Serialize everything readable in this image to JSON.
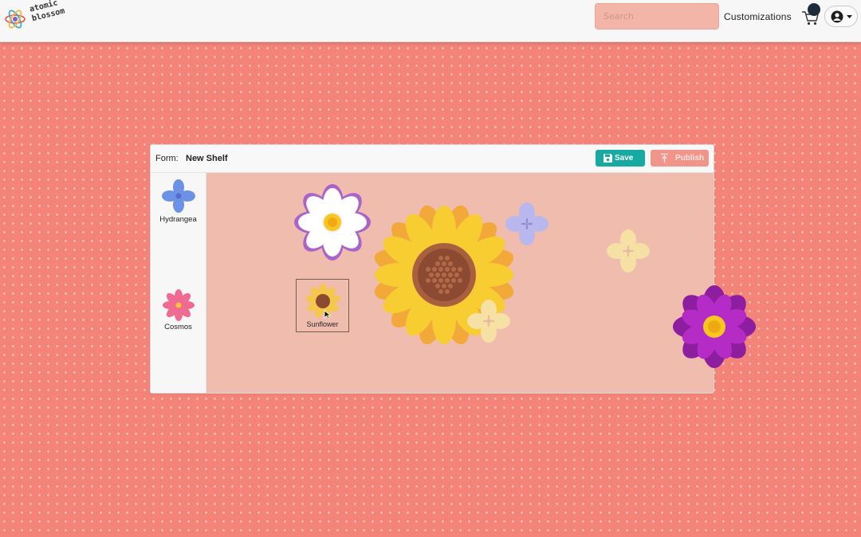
{
  "brand": {
    "line1": "atomic",
    "line2": "blossom"
  },
  "header": {
    "search_placeholder": "Search",
    "nav_customizations": "Customizations",
    "cart_icon": "cart-icon",
    "user_icon": "user-circle-icon"
  },
  "form": {
    "label": "Form:",
    "name": "New Shelf",
    "save_label": "Save",
    "publish_label": "Publish"
  },
  "palette": [
    {
      "label": "Hydrangea",
      "icon": "hydrangea-icon"
    },
    {
      "label": "Cosmos",
      "icon": "cosmos-icon"
    }
  ],
  "dragging": {
    "label": "Sunflower",
    "icon": "sunflower-icon"
  },
  "canvas_flowers": [
    "white-cosmos",
    "sunflower",
    "hydrangea-lavender",
    "hydrangea-cream",
    "hydrangea-cream",
    "purple-cosmos"
  ],
  "colors": {
    "background": "#f4847a",
    "canvas": "#efbcad",
    "save": "#17aaa3",
    "publish": "#f1948a",
    "search": "#f4b5a9"
  }
}
